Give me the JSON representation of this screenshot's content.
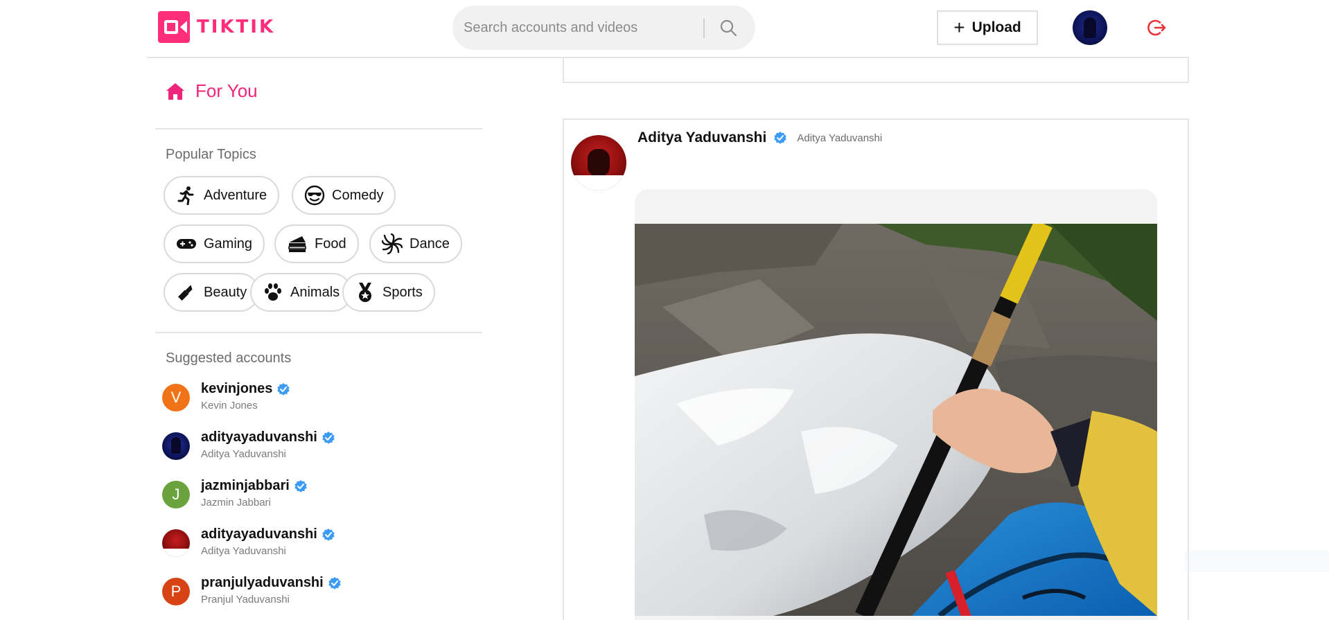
{
  "header": {
    "logo_text": "TIKTIK",
    "search_placeholder": "Search accounts and videos",
    "upload_label": "Upload"
  },
  "sidebar": {
    "for_you_label": "For You",
    "popular_topics_title": "Popular Topics",
    "topics": [
      {
        "label": "Adventure",
        "icon": "running-person-icon"
      },
      {
        "label": "Comedy",
        "icon": "sunglasses-face-icon"
      },
      {
        "label": "Gaming",
        "icon": "gamepad-icon"
      },
      {
        "label": "Food",
        "icon": "cake-icon"
      },
      {
        "label": "Dance",
        "icon": "spiral-icon"
      },
      {
        "label": "Beauty",
        "icon": "lipstick-icon"
      },
      {
        "label": "Animals",
        "icon": "paw-icon"
      },
      {
        "label": "Sports",
        "icon": "medal-icon"
      }
    ],
    "suggested_title": "Suggested accounts",
    "accounts": [
      {
        "username": "kevinjones",
        "name": "Kevin Jones",
        "initial": "V",
        "color": "#f07318"
      },
      {
        "username": "adityayaduvanshi",
        "name": "Aditya Yaduvanshi",
        "initial": "",
        "color": "#1a237e"
      },
      {
        "username": "jazminjabbari",
        "name": "Jazmin Jabbari",
        "initial": "J",
        "color": "#6aa33d"
      },
      {
        "username": "adityayaduvanshi",
        "name": "Aditya Yaduvanshi",
        "initial": "",
        "color": "#b71c1c"
      },
      {
        "username": "pranjulyaduvanshi",
        "name": "Pranjul Yaduvanshi",
        "initial": "P",
        "color": "#d84315"
      }
    ]
  },
  "feed": {
    "post": {
      "username": "Aditya Yaduvanshi",
      "handle": "Aditya Yaduvanshi"
    }
  },
  "colors": {
    "accent": "#f0247a",
    "verified": "#3b9bf5"
  }
}
